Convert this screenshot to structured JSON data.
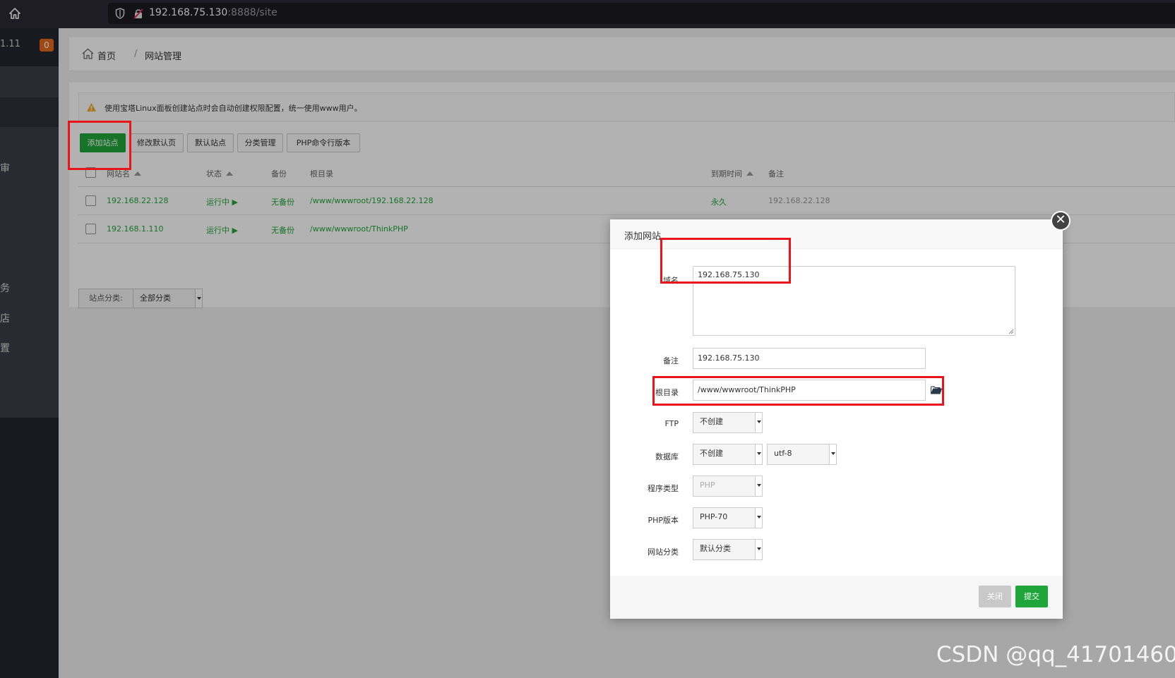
{
  "browser": {
    "url_host": "192.168.75.130",
    "url_path": ":8888/site"
  },
  "sidebar": {
    "version_fragment": "1.11",
    "badge_count": "0",
    "partial_items": [
      "审",
      "务",
      "店",
      "置"
    ]
  },
  "breadcrumb": {
    "home": "首页",
    "separator": "/",
    "current": "网站管理"
  },
  "alert": {
    "text": "使用宝塔Linux面板创建站点时会自动创建权限配置，统一使用www用户。"
  },
  "toolbar": {
    "add_site": "添加站点",
    "edit_default_page": "修改默认页",
    "default_site": "默认站点",
    "category_manage": "分类管理",
    "php_cli_version": "PHP命令行版本"
  },
  "table": {
    "headers": {
      "site_name": "网站名",
      "status": "状态",
      "backup": "备份",
      "root": "根目录",
      "expire": "到期时间",
      "note": "备注"
    },
    "rows": [
      {
        "name": "192.168.22.128",
        "status": "运行中 ▶",
        "backup": "无备份",
        "root": "/www/wwwroot/192.168.22.128",
        "expire": "永久",
        "note": "192.168.22.128"
      },
      {
        "name": "192.168.1.110",
        "status": "运行中 ▶",
        "backup": "无备份",
        "root": "/www/wwwroot/ThinkPHP",
        "expire": "",
        "note": ""
      }
    ]
  },
  "filter": {
    "label": "站点分类:",
    "value": "全部分类"
  },
  "modal": {
    "title": "添加网站",
    "close_symbol": "✕",
    "domain_label": "域名",
    "domain_value": "192.168.75.130",
    "note_label": "备注",
    "note_value": "192.168.75.130",
    "root_label": "根目录",
    "root_value": "/www/wwwroot/ThinkPHP",
    "ftp_label": "FTP",
    "ftp_value": "不创建",
    "db_label": "数据库",
    "db_value": "不创建",
    "db_charset": "utf-8",
    "program_label": "程序类型",
    "program_value": "PHP",
    "php_label": "PHP版本",
    "php_value": "PHP-70",
    "category_label": "网站分类",
    "category_value": "默认分类",
    "btn_close": "关闭",
    "btn_submit": "提交"
  },
  "watermark": "CSDN @qq_41701460",
  "colors": {
    "brand_green": "#20a53a",
    "annotation_red": "#e8161b",
    "sidebar_dark": "#22262e"
  }
}
